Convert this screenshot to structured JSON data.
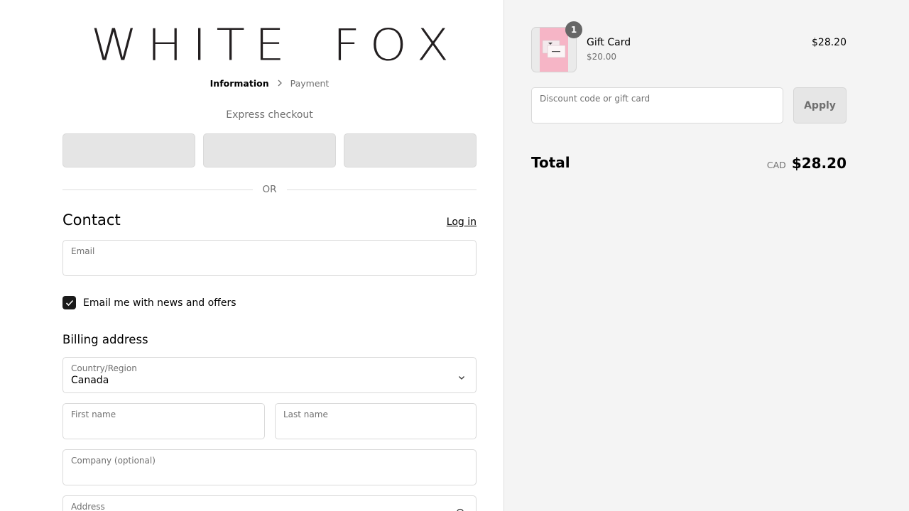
{
  "store": {
    "logo_letters": [
      "W",
      "H",
      "I",
      "T",
      "E",
      " ",
      "F",
      "O",
      "X"
    ]
  },
  "breadcrumb": {
    "steps": [
      "Information",
      "Payment"
    ]
  },
  "express": {
    "title": "Express checkout"
  },
  "divider": {
    "or_label": "OR"
  },
  "contact": {
    "title": "Contact",
    "login_label": "Log in",
    "email_label": "Email",
    "email_value": "",
    "newsletter_label": "Email me with news and offers",
    "newsletter_checked": true
  },
  "billing": {
    "title": "Billing address",
    "country_label": "Country/Region",
    "country_value": "Canada",
    "first_name_label": "First name",
    "last_name_label": "Last name",
    "company_label": "Company (optional)",
    "address_label": "Address"
  },
  "summary": {
    "item": {
      "quantity": "1",
      "name": "Gift Card",
      "variant": "$20.00",
      "price": "$28.20"
    },
    "discount_placeholder": "Discount code or gift card",
    "apply_label": "Apply",
    "total_label": "Total",
    "currency": "CAD",
    "total_amount": "$28.20"
  },
  "colors": {
    "sidebar_bg": "#f4f4f4",
    "checkbox_bg": "#1a1a1a",
    "thumbnail_pink": "#f6b5c6",
    "badge_bg": "#666666"
  },
  "icons": [
    "chevron-right-icon",
    "check-icon",
    "chevron-down-icon",
    "search-icon"
  ]
}
